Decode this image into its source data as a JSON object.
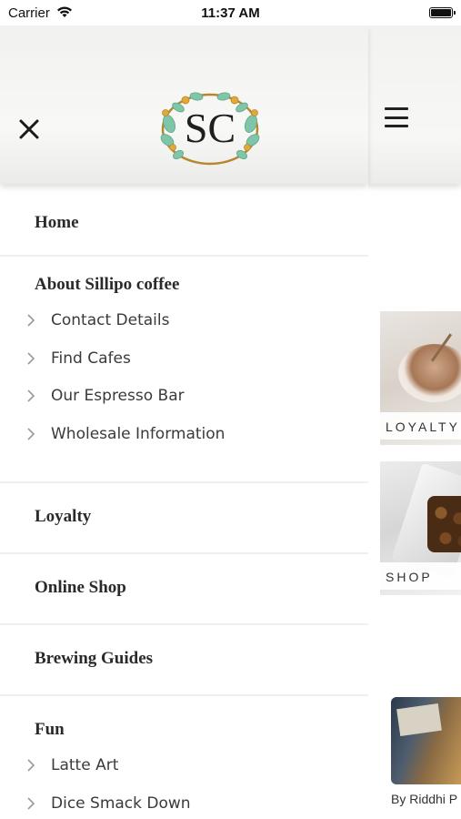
{
  "status_bar": {
    "carrier": "Carrier",
    "time": "11:37 AM"
  },
  "drawer": {
    "menu": [
      {
        "label": "Home",
        "children": []
      },
      {
        "label": "About Sillipo coffee",
        "children": [
          "Contact Details",
          "Find Cafes",
          "Our Espresso Bar",
          "Wholesale Information"
        ]
      },
      {
        "label": "Loyalty",
        "children": []
      },
      {
        "label": "Online Shop",
        "children": []
      },
      {
        "label": "Brewing Guides",
        "children": []
      },
      {
        "label": "Fun",
        "children": [
          "Latte Art",
          "Dice Smack Down"
        ]
      }
    ],
    "logo_text": "SC"
  },
  "background_page": {
    "tiles": [
      {
        "label": "LOYALTY"
      },
      {
        "label": "SHOP"
      }
    ],
    "byline": "By Riddhi P"
  },
  "colors": {
    "text_dark": "#2a2a2a",
    "divider": "#efefef",
    "logo_ring": "#b8862f",
    "logo_leaf": "#7fc6a8",
    "logo_flower": "#e0a93a"
  }
}
